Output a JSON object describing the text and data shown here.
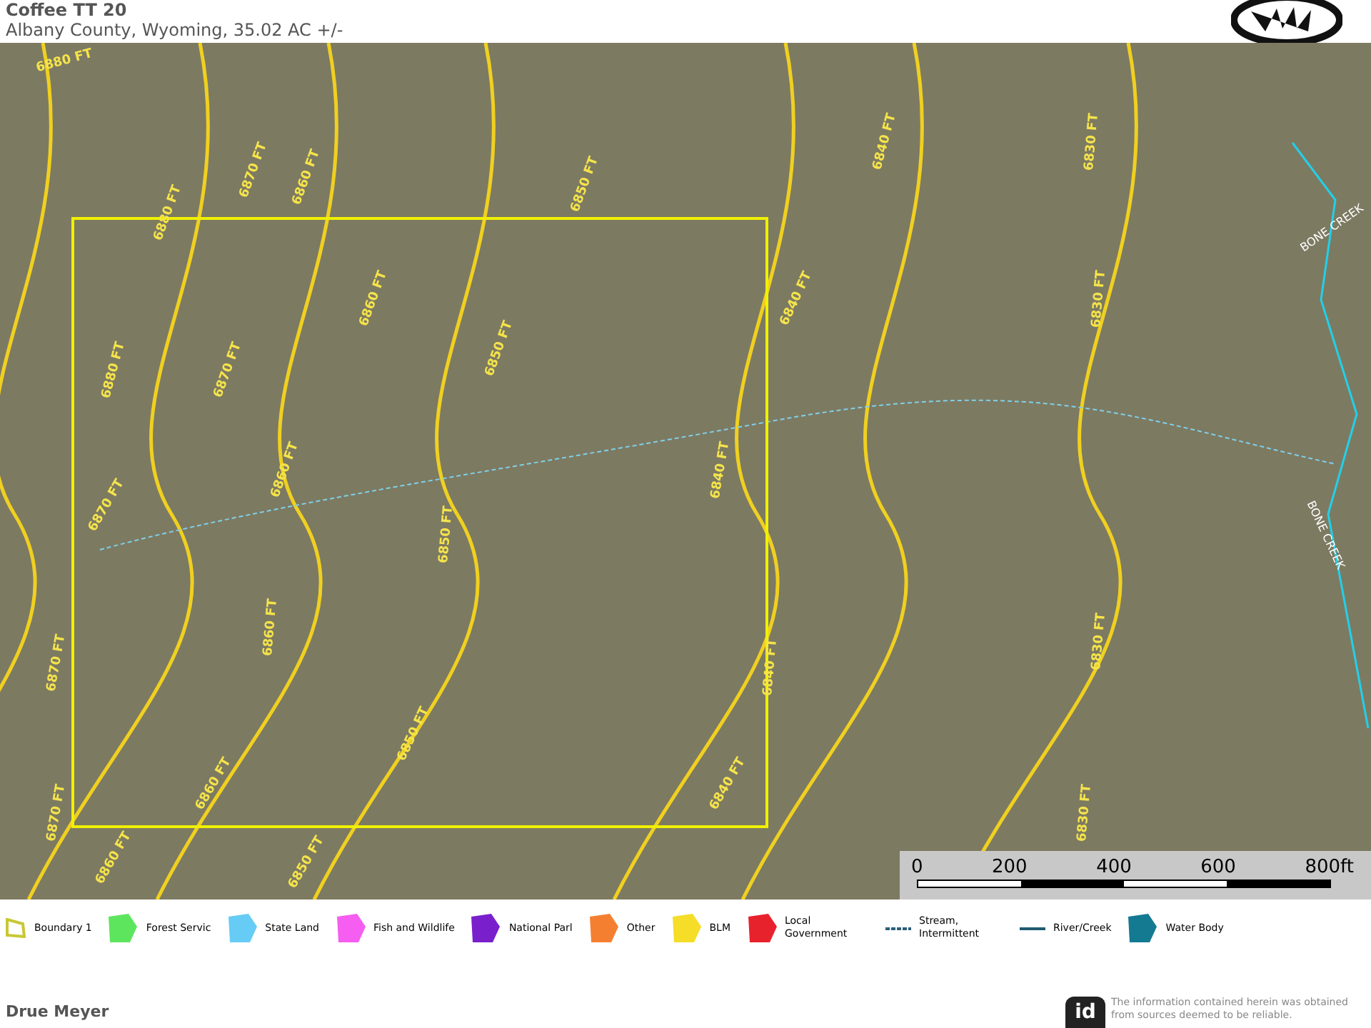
{
  "header": {
    "title": "Coffee TT 20",
    "subtitle": "Albany County, Wyoming, 35.02 AC +/-"
  },
  "map": {
    "contour_labels": [
      "6880 FT",
      "6880 FT",
      "6870 FT",
      "6860 FT",
      "6850 FT",
      "6840 FT",
      "6830 FT",
      "6880 FT",
      "6870 FT",
      "6860 FT",
      "6850 FT",
      "6840 FT",
      "6830 FT",
      "6870 FT",
      "6860 FT",
      "6850 FT",
      "6840 FT",
      "6860 FT",
      "6870 FT",
      "6840 FT",
      "6830 FT",
      "6850 FT",
      "6860 FT",
      "6840 FT",
      "6830 FT",
      "6870 FT",
      "6850 FT",
      "6860 FT"
    ],
    "creek_labels": [
      "BONE CREEK",
      "BONE CREEK"
    ],
    "scale_bar": [
      "0",
      "200",
      "400",
      "600",
      "800ft"
    ]
  },
  "legend": [
    {
      "kind": "outline",
      "label": "Boundary 1",
      "color": "#c8c832"
    },
    {
      "kind": "area",
      "label": "Forest Servic",
      "color": "#5ee55e"
    },
    {
      "kind": "area",
      "label": "State Land",
      "color": "#66ccf5"
    },
    {
      "kind": "area",
      "label": "Fish and Wildlife",
      "color": "#f55ef0"
    },
    {
      "kind": "area",
      "label": "National Parl",
      "color": "#7a1fcc"
    },
    {
      "kind": "area",
      "label": "Other",
      "color": "#f57f30"
    },
    {
      "kind": "area",
      "label": "BLM",
      "color": "#f5dd28"
    },
    {
      "kind": "area",
      "label": "Local Government",
      "color": "#e8222c"
    },
    {
      "kind": "dashed",
      "label": "Stream, Intermittent",
      "color": "#2a5f7a"
    },
    {
      "kind": "line",
      "label": "River/Creek",
      "color": "#1f5a72"
    },
    {
      "kind": "area",
      "label": "Water Body",
      "color": "#137a92"
    }
  ],
  "footer": {
    "agent": "Drue Meyer",
    "disclaimer": "The information contained herein was obtained from sources deemed to be reliable.",
    "badge": "id"
  }
}
